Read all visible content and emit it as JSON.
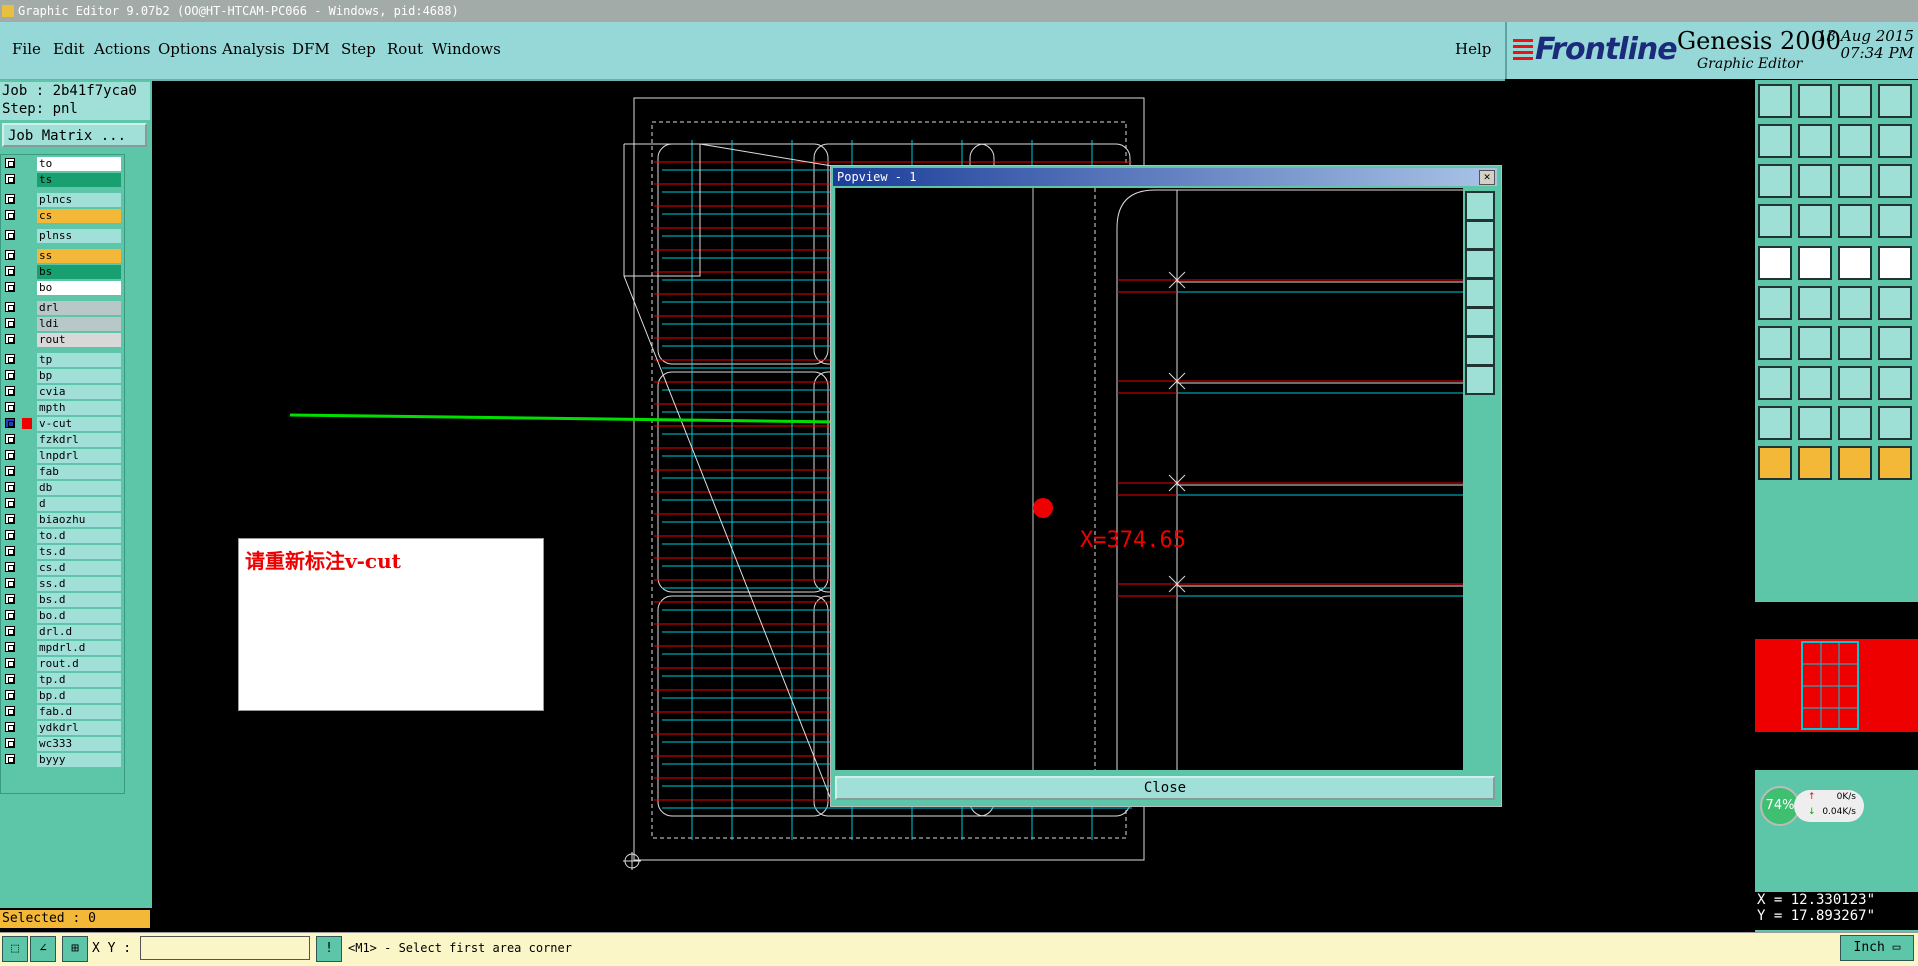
{
  "window": {
    "title": "Graphic Editor 9.07b2 (OO@HT-HTCAM-PC066 - Windows, pid:4688)"
  },
  "menu": {
    "items": [
      "File",
      "Edit",
      "Actions",
      "Options",
      "Analysis",
      "DFM",
      "Step",
      "Rout",
      "Windows"
    ],
    "help": "Help"
  },
  "brand": {
    "company": "Frontline",
    "product": "Genesis 2000",
    "subtitle": "Graphic Editor",
    "date": "13 Aug 2015",
    "time": "07:34 PM"
  },
  "job": {
    "job_line": "Job : 2b41f7yca0",
    "step_line": "Step: pnl",
    "matrix_button": "Job Matrix ..."
  },
  "layers": [
    {
      "name": "to",
      "color": "#ffffff"
    },
    {
      "name": "ts",
      "color": "#18a070"
    },
    {
      "name": "plncs",
      "color": "#a0e0d8"
    },
    {
      "name": "cs",
      "color": "#f4b838"
    },
    {
      "name": "plnss",
      "color": "#a0e0d8"
    },
    {
      "name": "ss",
      "color": "#f4b838"
    },
    {
      "name": "bs",
      "color": "#18a070"
    },
    {
      "name": "bo",
      "color": "#ffffff"
    },
    {
      "name": "drl",
      "color": "#b8c8c8"
    },
    {
      "name": "ldi",
      "color": "#b8c8c8"
    },
    {
      "name": "rout",
      "color": "#d8d8d8"
    },
    {
      "name": "tp",
      "color": "#a0e0d8"
    },
    {
      "name": "bp",
      "color": "#a0e0d8"
    },
    {
      "name": "cvia",
      "color": "#a0e0d8"
    },
    {
      "name": "mpth",
      "color": "#a0e0d8"
    },
    {
      "name": "v-cut",
      "color": "#a0e0d8",
      "active": true
    },
    {
      "name": "fzkdrl",
      "color": "#a0e0d8"
    },
    {
      "name": "lnpdrl",
      "color": "#a0e0d8"
    },
    {
      "name": "fab",
      "color": "#a0e0d8"
    },
    {
      "name": "db",
      "color": "#a0e0d8"
    },
    {
      "name": "d",
      "color": "#a0e0d8"
    },
    {
      "name": "biaozhu",
      "color": "#a0e0d8"
    },
    {
      "name": "to.d",
      "color": "#a0e0d8"
    },
    {
      "name": "ts.d",
      "color": "#a0e0d8"
    },
    {
      "name": "cs.d",
      "color": "#a0e0d8"
    },
    {
      "name": "ss.d",
      "color": "#a0e0d8"
    },
    {
      "name": "bs.d",
      "color": "#a0e0d8"
    },
    {
      "name": "bo.d",
      "color": "#a0e0d8"
    },
    {
      "name": "drl.d",
      "color": "#a0e0d8"
    },
    {
      "name": "mpdrl.d",
      "color": "#a0e0d8"
    },
    {
      "name": "rout.d",
      "color": "#a0e0d8"
    },
    {
      "name": "tp.d",
      "color": "#a0e0d8"
    },
    {
      "name": "bp.d",
      "color": "#a0e0d8"
    },
    {
      "name": "fab.d",
      "color": "#a0e0d8"
    },
    {
      "name": "ydkdrl",
      "color": "#a0e0d8"
    },
    {
      "name": "wc333",
      "color": "#a0e0d8"
    },
    {
      "name": "byyy",
      "color": "#a0e0d8"
    }
  ],
  "status": {
    "selected": "Selected : 0",
    "xy_label": "X Y :",
    "xy_value": "",
    "prompt": "<M1> - Select first area corner",
    "units": "Inch"
  },
  "coords": {
    "x": "X = 12.330123\"",
    "y": "Y = 17.893267\""
  },
  "popview": {
    "title": "Popview - 1",
    "close_label": "Close"
  },
  "annotation": {
    "message": "请重新标注v-cut",
    "cursor_label": "X=374.65"
  },
  "network": {
    "percent": "74%",
    "up": "0K/s",
    "down": "0.04K/s"
  },
  "colors": {
    "panel": "#5ec6a8",
    "menu": "#96d8d8",
    "layer_box": "#a0e0d8",
    "highlight": "#f4b838",
    "accent_red": "#ee0000",
    "cyan_line": "#00c8d8",
    "arrow_green": "#00e000"
  }
}
